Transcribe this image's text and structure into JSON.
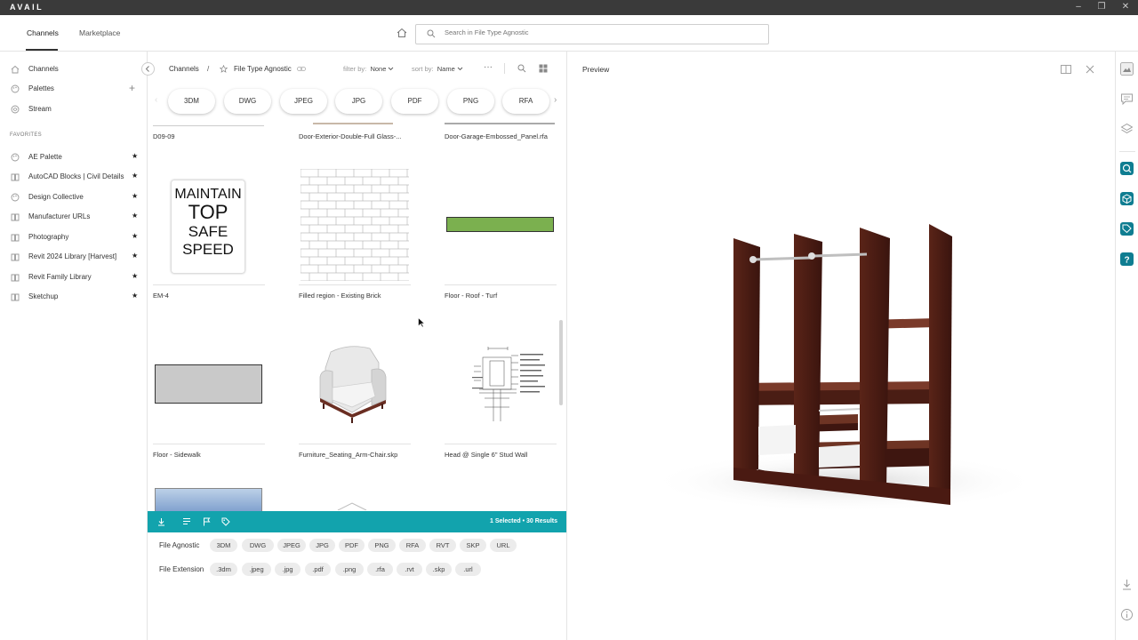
{
  "app": {
    "logo": "AVAIL",
    "win_min": "–",
    "win_max": "❐",
    "win_close": "✕"
  },
  "header": {
    "tabs": [
      {
        "label": "Channels"
      },
      {
        "label": "Marketplace"
      }
    ],
    "search_placeholder": "Search in File Type Agnostic"
  },
  "sidebar": {
    "items": [
      {
        "label": "Channels"
      },
      {
        "label": "Palettes"
      },
      {
        "label": "Stream"
      }
    ],
    "add_symbol": "+",
    "favorites_header": "FAVORITES",
    "favorites": [
      {
        "label": "AE Palette",
        "star": "★"
      },
      {
        "label": "AutoCAD Blocks | Civil Details",
        "star": "★"
      },
      {
        "label": "Design Collective",
        "star": "★"
      },
      {
        "label": "Manufacturer URLs",
        "star": "★"
      },
      {
        "label": "Photography",
        "star": "★"
      },
      {
        "label": "Revit 2024 Library [Harvest]",
        "star": "★"
      },
      {
        "label": "Revit Family Library",
        "star": "★"
      },
      {
        "label": "Sketchup",
        "star": "★"
      }
    ]
  },
  "toolbar": {
    "crumb_root": "Channels",
    "crumb_sep": "/",
    "crumb_current": "File Type Agnostic",
    "filter_label": "filter by:",
    "filter_value": "None",
    "sort_label": "sort by:",
    "sort_value": "Name",
    "more": "···"
  },
  "filter_pills": [
    "3DM",
    "DWG",
    "JPEG",
    "JPG",
    "PDF",
    "PNG",
    "RFA"
  ],
  "cards": [
    {
      "label": "D09-09"
    },
    {
      "label": "Door-Exterior-Double-Full Glass-..."
    },
    {
      "label": "Door-Garage-Embossed_Panel.rfa"
    },
    {
      "label": "EM-4",
      "sign_lines": [
        "MAINTAIN",
        "TOP",
        "SAFE",
        "SPEED"
      ]
    },
    {
      "label": "Filled region - Existing Brick"
    },
    {
      "label": "Floor - Roof - Turf"
    },
    {
      "label": "Floor - Sidewalk"
    },
    {
      "label": "Furniture_Seating_Arm-Chair.skp"
    },
    {
      "label": "Head @ Single 6\"  Stud Wall"
    }
  ],
  "selection_bar": {
    "status": "1 Selected  •  30 Results",
    "accent": "#12a3ad"
  },
  "tag_rows": [
    {
      "label": "File Agnostic",
      "chips": [
        "3DM",
        "DWG",
        "JPEG",
        "JPG",
        "PDF",
        "PNG",
        "RFA",
        "RVT",
        "SKP",
        "URL"
      ]
    },
    {
      "label": "File Extension",
      "chips": [
        ".3dm",
        ".jpeg",
        ".jpg",
        ".pdf",
        ".png",
        ".rfa",
        ".rvt",
        ".skp",
        ".url"
      ]
    }
  ],
  "preview": {
    "title": "Preview"
  },
  "up_arrow": "⇧"
}
